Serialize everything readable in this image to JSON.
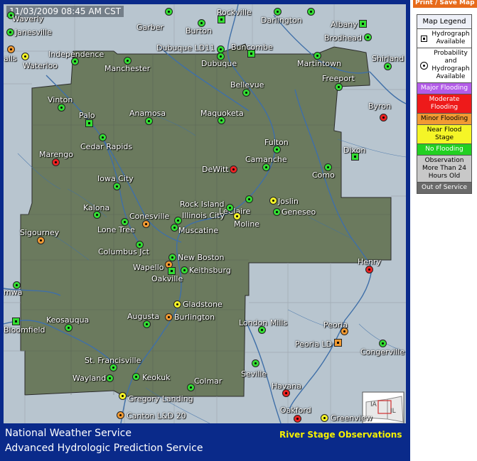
{
  "toolbar": {
    "print_label": "Print / Save Map"
  },
  "map": {
    "timestamp": "11/03/2009 08:45 AM CST",
    "sites": [
      {
        "name": "Waverly",
        "status": "green",
        "marker": "circle"
      },
      {
        "name": "Janesville",
        "status": "green",
        "marker": "circle"
      },
      {
        "name": "Garber",
        "status": "green",
        "marker": "circle"
      },
      {
        "name": "Rockville",
        "status": "green",
        "marker": "square"
      },
      {
        "name": "Burton",
        "status": "green",
        "marker": "circle"
      },
      {
        "name": "Darlington",
        "status": "green",
        "marker": "circle"
      },
      {
        "name": "Albany",
        "status": "green",
        "marker": "square"
      },
      {
        "name": "Brodhead",
        "status": "green",
        "marker": "circle"
      },
      {
        "name": "Falls",
        "status": "orange",
        "marker": "circle"
      },
      {
        "name": "Waterloo",
        "status": "yellow",
        "marker": "circle"
      },
      {
        "name": "Independence",
        "status": "green",
        "marker": "circle"
      },
      {
        "name": "Manchester",
        "status": "green",
        "marker": "circle"
      },
      {
        "name": "Dubuque LD11",
        "status": "green",
        "marker": "circle"
      },
      {
        "name": "Buncombe",
        "status": "green",
        "marker": "square"
      },
      {
        "name": "Dubuque",
        "status": "green",
        "marker": "circle"
      },
      {
        "name": "Martintown",
        "status": "green",
        "marker": "circle"
      },
      {
        "name": "Shirland",
        "status": "green",
        "marker": "circle"
      },
      {
        "name": "Freeport",
        "status": "green",
        "marker": "circle"
      },
      {
        "name": "Bellevue",
        "status": "green",
        "marker": "circle"
      },
      {
        "name": "Vinton",
        "status": "green",
        "marker": "circle"
      },
      {
        "name": "Palo",
        "status": "green",
        "marker": "square"
      },
      {
        "name": "Anamosa",
        "status": "green",
        "marker": "circle"
      },
      {
        "name": "Maquoketa",
        "status": "green",
        "marker": "circle"
      },
      {
        "name": "Byron",
        "status": "red",
        "marker": "circle"
      },
      {
        "name": "Cedar Rapids",
        "status": "green",
        "marker": "circle"
      },
      {
        "name": "Fulton",
        "status": "green",
        "marker": "circle"
      },
      {
        "name": "Dixon",
        "status": "green",
        "marker": "square"
      },
      {
        "name": "Marengo",
        "status": "red",
        "marker": "circle"
      },
      {
        "name": "DeWitt",
        "status": "red",
        "marker": "circle"
      },
      {
        "name": "Camanche",
        "status": "green",
        "marker": "circle"
      },
      {
        "name": "Como",
        "status": "green",
        "marker": "circle"
      },
      {
        "name": "Iowa City",
        "status": "green",
        "marker": "circle"
      },
      {
        "name": "LeClaire",
        "status": "green",
        "marker": "circle"
      },
      {
        "name": "Joslin",
        "status": "yellow",
        "marker": "circle"
      },
      {
        "name": "Geneseo",
        "status": "green",
        "marker": "circle"
      },
      {
        "name": "Kalona",
        "status": "green",
        "marker": "circle"
      },
      {
        "name": "Rock Island",
        "status": "green",
        "marker": "circle"
      },
      {
        "name": "Illinois City",
        "status": "green",
        "marker": "circle"
      },
      {
        "name": "Moline",
        "status": "yellow",
        "marker": "circle"
      },
      {
        "name": "Conesville",
        "status": "orange",
        "marker": "circle"
      },
      {
        "name": "Lone Tree",
        "status": "green",
        "marker": "circle"
      },
      {
        "name": "Muscatine",
        "status": "green",
        "marker": "circle"
      },
      {
        "name": "Sigourney",
        "status": "orange",
        "marker": "circle"
      },
      {
        "name": "Columbus Jct",
        "status": "green",
        "marker": "circle"
      },
      {
        "name": "New Boston",
        "status": "green",
        "marker": "circle"
      },
      {
        "name": "Henry",
        "status": "red",
        "marker": "circle"
      },
      {
        "name": "Wapello",
        "status": "orange",
        "marker": "circle"
      },
      {
        "name": "Keithsburg",
        "status": "green",
        "marker": "circle"
      },
      {
        "name": "Oakville",
        "status": "green",
        "marker": "square"
      },
      {
        "name": "Gladstone",
        "status": "yellow",
        "marker": "circle"
      },
      {
        "name": "Burlington",
        "status": "orange",
        "marker": "circle"
      },
      {
        "name": "Keosauqua",
        "status": "green",
        "marker": "circle"
      },
      {
        "name": "Augusta",
        "status": "green",
        "marker": "circle"
      },
      {
        "name": "London Mills",
        "status": "green",
        "marker": "circle"
      },
      {
        "name": "Peoria",
        "status": "orange",
        "marker": "circle"
      },
      {
        "name": "Bloomfield",
        "status": "green",
        "marker": "square"
      },
      {
        "name": "Peoria LD",
        "status": "orange",
        "marker": "square"
      },
      {
        "name": "Congerville",
        "status": "green",
        "marker": "circle"
      },
      {
        "name": "St. Francisville",
        "status": "green",
        "marker": "circle"
      },
      {
        "name": "Wayland",
        "status": "green",
        "marker": "circle"
      },
      {
        "name": "Keokuk",
        "status": "green",
        "marker": "circle"
      },
      {
        "name": "Seville",
        "status": "green",
        "marker": "circle"
      },
      {
        "name": "Colmar",
        "status": "green",
        "marker": "circle"
      },
      {
        "name": "Havana",
        "status": "red",
        "marker": "circle"
      },
      {
        "name": "Gregory Landing",
        "status": "yellow",
        "marker": "circle"
      },
      {
        "name": "Oakford",
        "status": "red",
        "marker": "circle"
      },
      {
        "name": "Canton L&D 20",
        "status": "orange",
        "marker": "circle"
      },
      {
        "name": "Greenview",
        "status": "yellow",
        "marker": "circle"
      },
      {
        "name": "Ottumwa",
        "status": "green",
        "marker": "circle"
      }
    ],
    "inset_labels": [
      "IA",
      "IL"
    ]
  },
  "footer": {
    "line1": "National Weather Service",
    "line2": "Advanced Hydrologic Prediction Service",
    "product": "River Stage Observations"
  },
  "legend": {
    "title": "Map Legend",
    "hydrograph": "Hydrograph Available",
    "probability": "Probability and Hydrograph Available",
    "categories": [
      {
        "label": "Major Flooding",
        "color": "#b35ce8",
        "text_color": "#ffffff"
      },
      {
        "label": "Moderate Flooding",
        "color": "#ee1a1a",
        "text_color": "#ffffff"
      },
      {
        "label": "Minor Flooding",
        "color": "#f19a33",
        "text_color": "#000000"
      },
      {
        "label": "Near Flood Stage",
        "color": "#f5f527",
        "text_color": "#000000"
      },
      {
        "label": "No Flooding",
        "color": "#22d022",
        "text_color": "#ffffff"
      },
      {
        "label": "Observation More Than 24 Hours Old",
        "color": "#c8c8c8",
        "text_color": "#000000"
      },
      {
        "label": "Out of Service",
        "color": "#6a6a6a",
        "text_color": "#ffffff"
      }
    ]
  }
}
